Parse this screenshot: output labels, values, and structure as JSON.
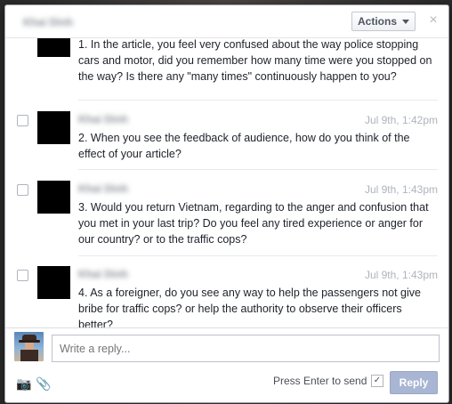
{
  "header": {
    "title": "Khai Dinh",
    "actions_label": "Actions",
    "close_glyph": "×"
  },
  "messages": [
    {
      "text": "1. In the article, you feel very confused about the way police stopping cars and motor, did you remember how many time were you stopped on the way? Is there any \"many times\" continuously happen to you?"
    },
    {
      "name": "Khai Dinh",
      "time": "Jul 9th, 1:42pm",
      "text": "2. When you see the feedback of audience, how do you think of the effect of your article?"
    },
    {
      "name": "Khai Dinh",
      "time": "Jul 9th, 1:43pm",
      "text": "3. Would you return Vietnam, regarding to the anger and confusion that you met in your last trip? Do you feel any tired experience or anger for our country? or to the traffic cops?"
    },
    {
      "name": "Khai Dinh",
      "time": "Jul 9th, 1:43pm",
      "text": "4. As a foreigner, do you see any way to help the passengers not give bribe for traffic cops? or help the authority to observe their officers better?"
    }
  ],
  "composer": {
    "placeholder": "Write a reply...",
    "press_enter_label": "Press Enter to send",
    "press_enter_checked": "✓",
    "reply_label": "Reply",
    "camera_icon": "📷",
    "attach_icon": "📎"
  }
}
